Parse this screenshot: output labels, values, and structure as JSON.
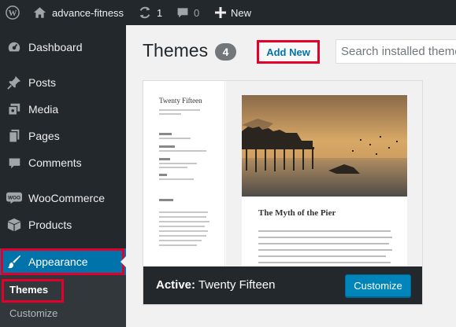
{
  "admin_bar": {
    "wp_logo_icon": "wordpress-logo-icon",
    "site_name": "advance-fitness",
    "updates_count": "1",
    "comments_count": "0",
    "new_label": "New"
  },
  "sidebar": {
    "items": [
      {
        "label": "Dashboard",
        "icon": "dashboard-icon"
      },
      {
        "label": "Posts",
        "icon": "pin-icon"
      },
      {
        "label": "Media",
        "icon": "media-icon"
      },
      {
        "label": "Pages",
        "icon": "pages-icon"
      },
      {
        "label": "Comments",
        "icon": "comment-icon"
      },
      {
        "label": "WooCommerce",
        "icon": "woo-icon"
      },
      {
        "label": "Products",
        "icon": "box-icon"
      },
      {
        "label": "Appearance",
        "icon": "brush-icon"
      }
    ],
    "submenu": {
      "themes": "Themes",
      "customize": "Customize"
    }
  },
  "main": {
    "title": "Themes",
    "count": "4",
    "add_new": "Add New",
    "search_placeholder": "Search installed themes..."
  },
  "theme_card": {
    "screenshot_title": "Twenty Fifteen",
    "post_title": "The Myth of the Pier",
    "active_prefix": "Active:",
    "active_name": "Twenty Fifteen",
    "customize_label": "Customize"
  },
  "colors": {
    "admin_dark": "#23282d",
    "accent_blue": "#0073aa",
    "button_blue": "#0085ba",
    "highlight_red": "#e3002b"
  }
}
